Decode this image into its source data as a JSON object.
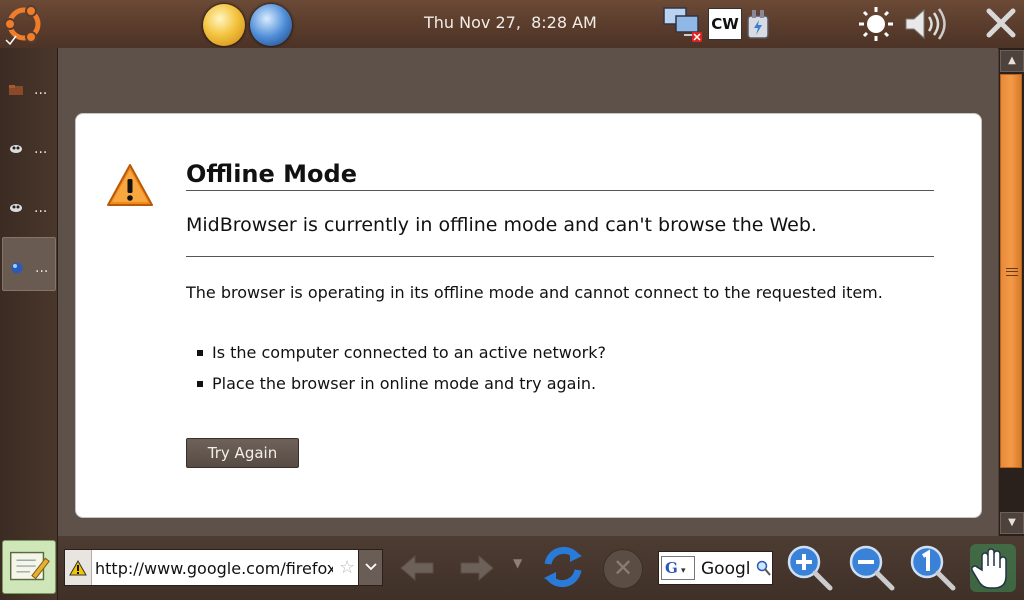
{
  "top_panel": {
    "clock": "Thu Nov 27,  8:28 AM",
    "cw_label": "CW"
  },
  "left_dock": {
    "items": [
      {
        "label": "..."
      },
      {
        "label": "..."
      },
      {
        "label": "..."
      },
      {
        "label": "..."
      }
    ]
  },
  "error_page": {
    "title": "Offline Mode",
    "subtitle": "MidBrowser is currently in offline mode and can't browse the Web.",
    "description": "The browser is operating in its offline mode and cannot connect to the requested item.",
    "bullets": [
      "Is the computer connected to an active network?",
      "Place the browser in online mode and try again."
    ],
    "try_again_label": "Try Again"
  },
  "toolbar": {
    "url": "http://www.google.com/firefox",
    "search_engine": "G",
    "search_text": "Googl"
  },
  "colors": {
    "panel_brown": "#5a3c2c",
    "scroll_thumb": "#f39a47",
    "warning_orange": "#f08a1a"
  }
}
